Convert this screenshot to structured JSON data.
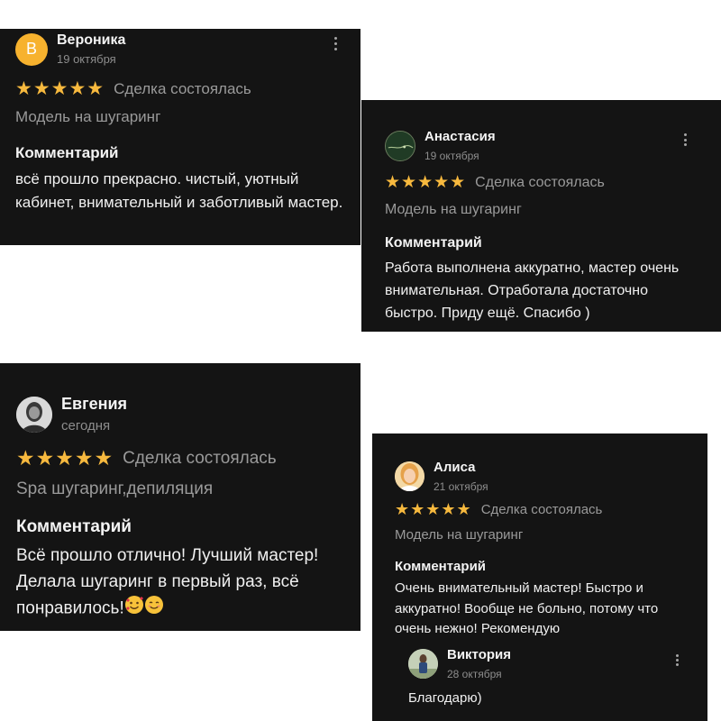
{
  "reviews": [
    {
      "author": "Вероника",
      "avatar_letter": "В",
      "avatar_color": "#f7b22e",
      "date": "19 октября",
      "stars": "★★★★★",
      "rating": 5,
      "deal_status": "Сделка состоялась",
      "service": "Модель на шугаринг",
      "comment_title": "Комментарий",
      "comment": "всё прошло прекрасно. чистый, уютный кабинет, внимательный и заботливый мастер."
    },
    {
      "author": "Анастасия",
      "date": "19 октября",
      "stars": "★★★★★",
      "rating": 5,
      "deal_status": "Сделка состоялась",
      "service": "Модель на шугаринг",
      "comment_title": "Комментарий",
      "comment": "Работа выполнена аккуратно, мастер очень внимательная. Отработала достаточно быстро. Приду ещё. Спасибо )"
    },
    {
      "author": "Евгения",
      "date": "сегодня",
      "stars": "★★★★★",
      "rating": 5,
      "deal_status": "Сделка состоялась",
      "service": "Spa шугаринг,депиляция",
      "comment_title": "Комментарий",
      "comment": "Всё прошло отлично! Лучший мастер! Делала шугаринг в первый раз, всё понравилось!"
    },
    {
      "author": "Алиса",
      "date": "21 октября",
      "stars": "★★★★★",
      "rating": 5,
      "deal_status": "Сделка состоялась",
      "service": "Модель на шугаринг",
      "comment_title": "Комментарий",
      "comment": "Очень внимательный мастер! Быстро и аккуратно! Вообще не больно, потому что очень нежно! Рекомендую",
      "reply": {
        "author": "Виктория",
        "date": "28 октября",
        "text": "Благодарю)"
      }
    }
  ],
  "colors": {
    "card_bg": "#141414",
    "star": "#f7b93e",
    "muted_text": "#9a9a9a",
    "date_text": "#8d8d8d"
  }
}
